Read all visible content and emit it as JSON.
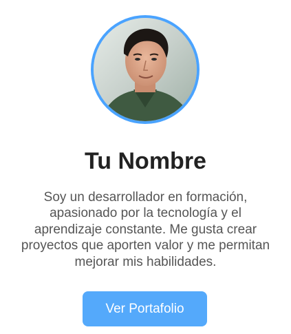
{
  "profile": {
    "avatar_icon": "profile-photo",
    "name": "Tu Nombre",
    "bio_lines": [
      "Soy un desarrollador en formación,",
      "apasionado por la tecnología y el",
      "aprendizaje constante. Me gusta crear",
      "proyectos que aporten valor y me permitan",
      "mejorar mis habilidades."
    ],
    "button_label": "Ver Portafolio"
  },
  "colors": {
    "accent": "#4aa3ff",
    "button": "#54a9fb",
    "heading": "#222222",
    "body_text": "#555555"
  }
}
